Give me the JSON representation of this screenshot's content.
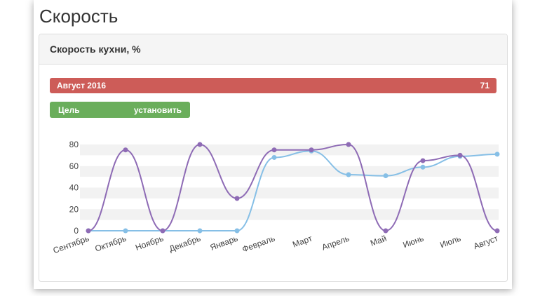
{
  "page": {
    "title": "Скорость"
  },
  "panel": {
    "heading": "Скорость кухни, %"
  },
  "period_bar": {
    "label": "Август 2016",
    "value": "71",
    "color": "#cd5c58"
  },
  "goal_bar": {
    "label": "Цель",
    "action": "установить",
    "color": "#6aae5b"
  },
  "chart_data": {
    "type": "line",
    "categories": [
      "Сентябрь",
      "Октябрь",
      "Ноябрь",
      "Декабрь",
      "Январь",
      "Февраль",
      "Март",
      "Апрель",
      "Май",
      "Июнь",
      "Июль",
      "Август"
    ],
    "series": [
      {
        "color": "#8e6bb5",
        "values": [
          0,
          75,
          0,
          80,
          30,
          75,
          75,
          80,
          0,
          65,
          70,
          0
        ]
      },
      {
        "color": "#86bfe6",
        "values": [
          0,
          0,
          0,
          0,
          0,
          68,
          74,
          52,
          51,
          59,
          69,
          71
        ]
      }
    ],
    "yticks": [
      "0",
      "20",
      "40",
      "60",
      "80"
    ],
    "ylim": [
      0,
      80
    ],
    "grid": true
  }
}
